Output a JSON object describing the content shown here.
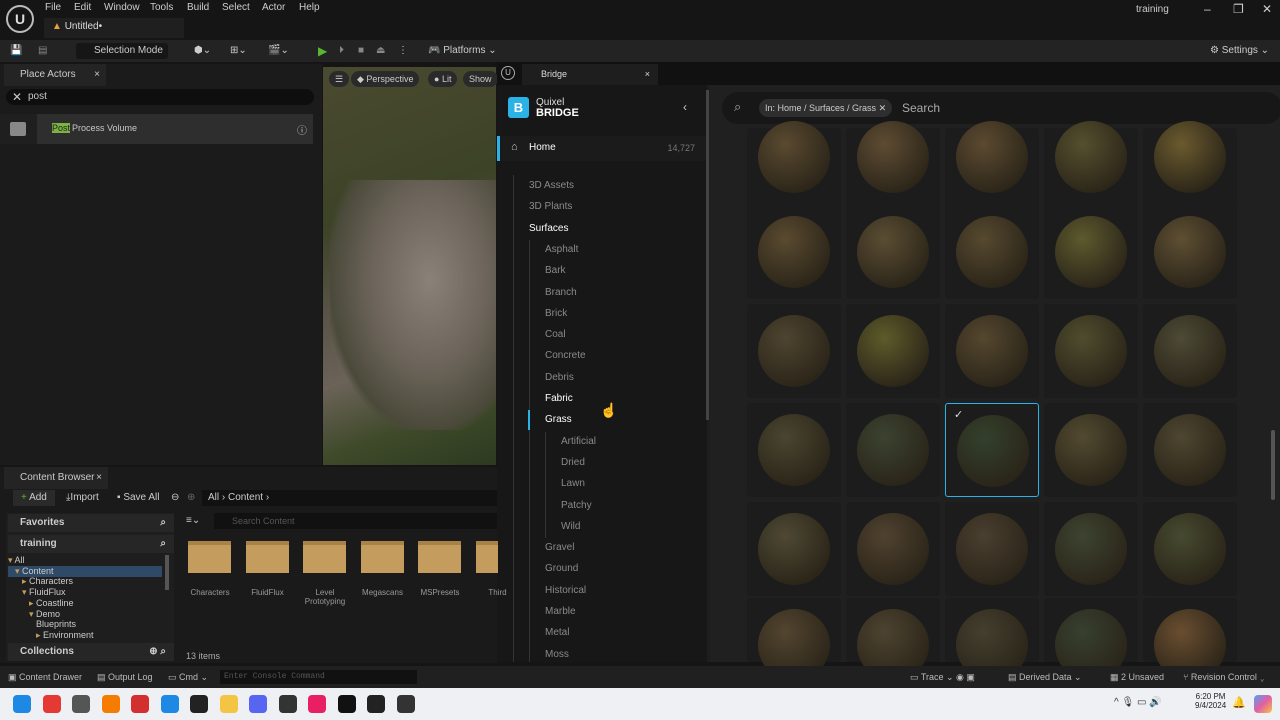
{
  "menubar": {
    "items": [
      "File",
      "Edit",
      "Window",
      "Tools",
      "Build",
      "Select",
      "Actor",
      "Help"
    ],
    "tab": "Untitled•",
    "project": "training"
  },
  "toolbar": {
    "selection_mode": "Selection Mode",
    "platforms": "Platforms",
    "settings": "Settings"
  },
  "place_actors": {
    "tab": "Place Actors",
    "search": "post",
    "result_highlight": "Post",
    "result": "Process Volume"
  },
  "viewport": {
    "perspective": "Perspective",
    "lit": "Lit",
    "show": "Show"
  },
  "bridge": {
    "tab": "Bridge",
    "logo_top": "Quixel",
    "logo_bottom": "BRIDGE",
    "home": "Home",
    "home_count": "14,727",
    "top_items": [
      "3D Assets",
      "3D Plants",
      "Surfaces"
    ],
    "surfaces": [
      "Asphalt",
      "Bark",
      "Branch",
      "Brick",
      "Coal",
      "Concrete",
      "Debris",
      "Fabric",
      "Grass"
    ],
    "grass_children": [
      "Artificial",
      "Dried",
      "Lawn",
      "Patchy",
      "Wild"
    ],
    "more_surfaces": [
      "Gravel",
      "Ground",
      "Historical",
      "Marble",
      "Metal",
      "Moss"
    ],
    "filter_chip": "In: Home / Surfaces / Grass",
    "search_placeholder": "Search",
    "sphere_colors": [
      "#5a4a30",
      "#5e4c33",
      "#5c4a31",
      "#55502e",
      "#6a5a2e",
      "#5a4a30",
      "#5b4d33",
      "#56492f",
      "#5d5a2e",
      "#5e4f33",
      "#4e4430",
      "#5e5b2a",
      "#55472f",
      "#4f4d2e",
      "#4d4a35",
      "#4a4530",
      "#3b4330",
      "#33402c",
      "#524a30",
      "#4e4630",
      "#4e4834",
      "#504230",
      "#4a3f30",
      "#3d4430",
      "#464a30",
      "#534530",
      "#4d4330",
      "#443f2e",
      "#374030",
      "#6a4e30"
    ],
    "selected_index": 17
  },
  "content_browser": {
    "tab": "Content Browser",
    "add": "Add",
    "import": "Import",
    "save_all": "Save All",
    "path": [
      "All",
      "Content"
    ],
    "search_placeholder": "Search Content",
    "favorites": "Favorites",
    "project": "training",
    "collections": "Collections",
    "tree": [
      "All",
      "Content",
      "Characters",
      "FluidFlux",
      "Coastline",
      "Demo",
      "Blueprints",
      "Environment"
    ],
    "folders": [
      "Characters",
      "FluidFlux",
      "Level Prototyping",
      "Megascans",
      "MSPresets",
      "Third"
    ],
    "count": "13 items"
  },
  "statusbar": {
    "content_drawer": "Content Drawer",
    "output_log": "Output Log",
    "cmd": "Cmd",
    "console_placeholder": "Enter Console Command",
    "trace": "Trace",
    "derived_data": "Derived Data",
    "unsaved": "2 Unsaved",
    "revision_control": "Revision Control"
  },
  "taskbar": {
    "time": "6:20 PM",
    "date": "9/4/2024"
  }
}
